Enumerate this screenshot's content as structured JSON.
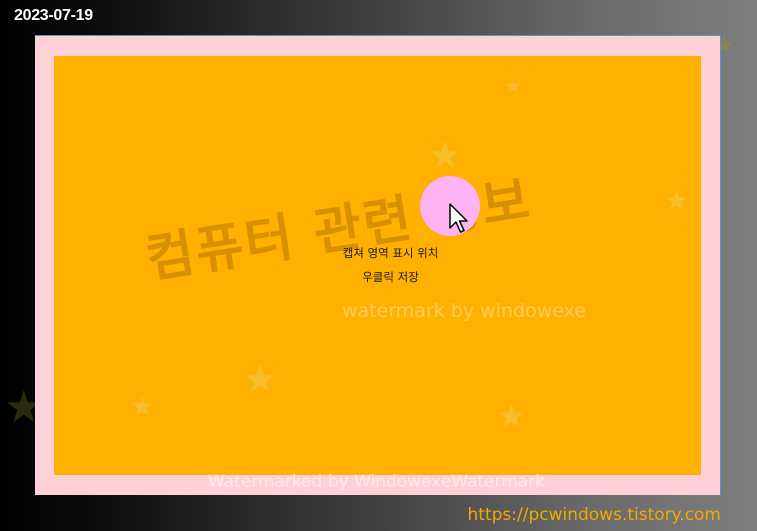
{
  "header": {
    "date": "2023-07-19"
  },
  "capture": {
    "line1": "캡쳐 영역 표시 위치",
    "line2": "우클릭 저장"
  },
  "watermarks": {
    "korean": "컴퓨터 관련 정보",
    "english": "watermark by windowexe",
    "bottom": "Watermarked by WindowexeWatermark"
  },
  "footer": {
    "url": "https://pcwindows.tistory.com"
  },
  "colors": {
    "capture_fill": "#ffb000",
    "frame_fill": "#ffd1d6",
    "cursor_highlight": "#ffb2f4",
    "url_text": "#f2a900"
  },
  "icons": {
    "cursor": "mouse-pointer-icon",
    "stars": "star-icon"
  }
}
